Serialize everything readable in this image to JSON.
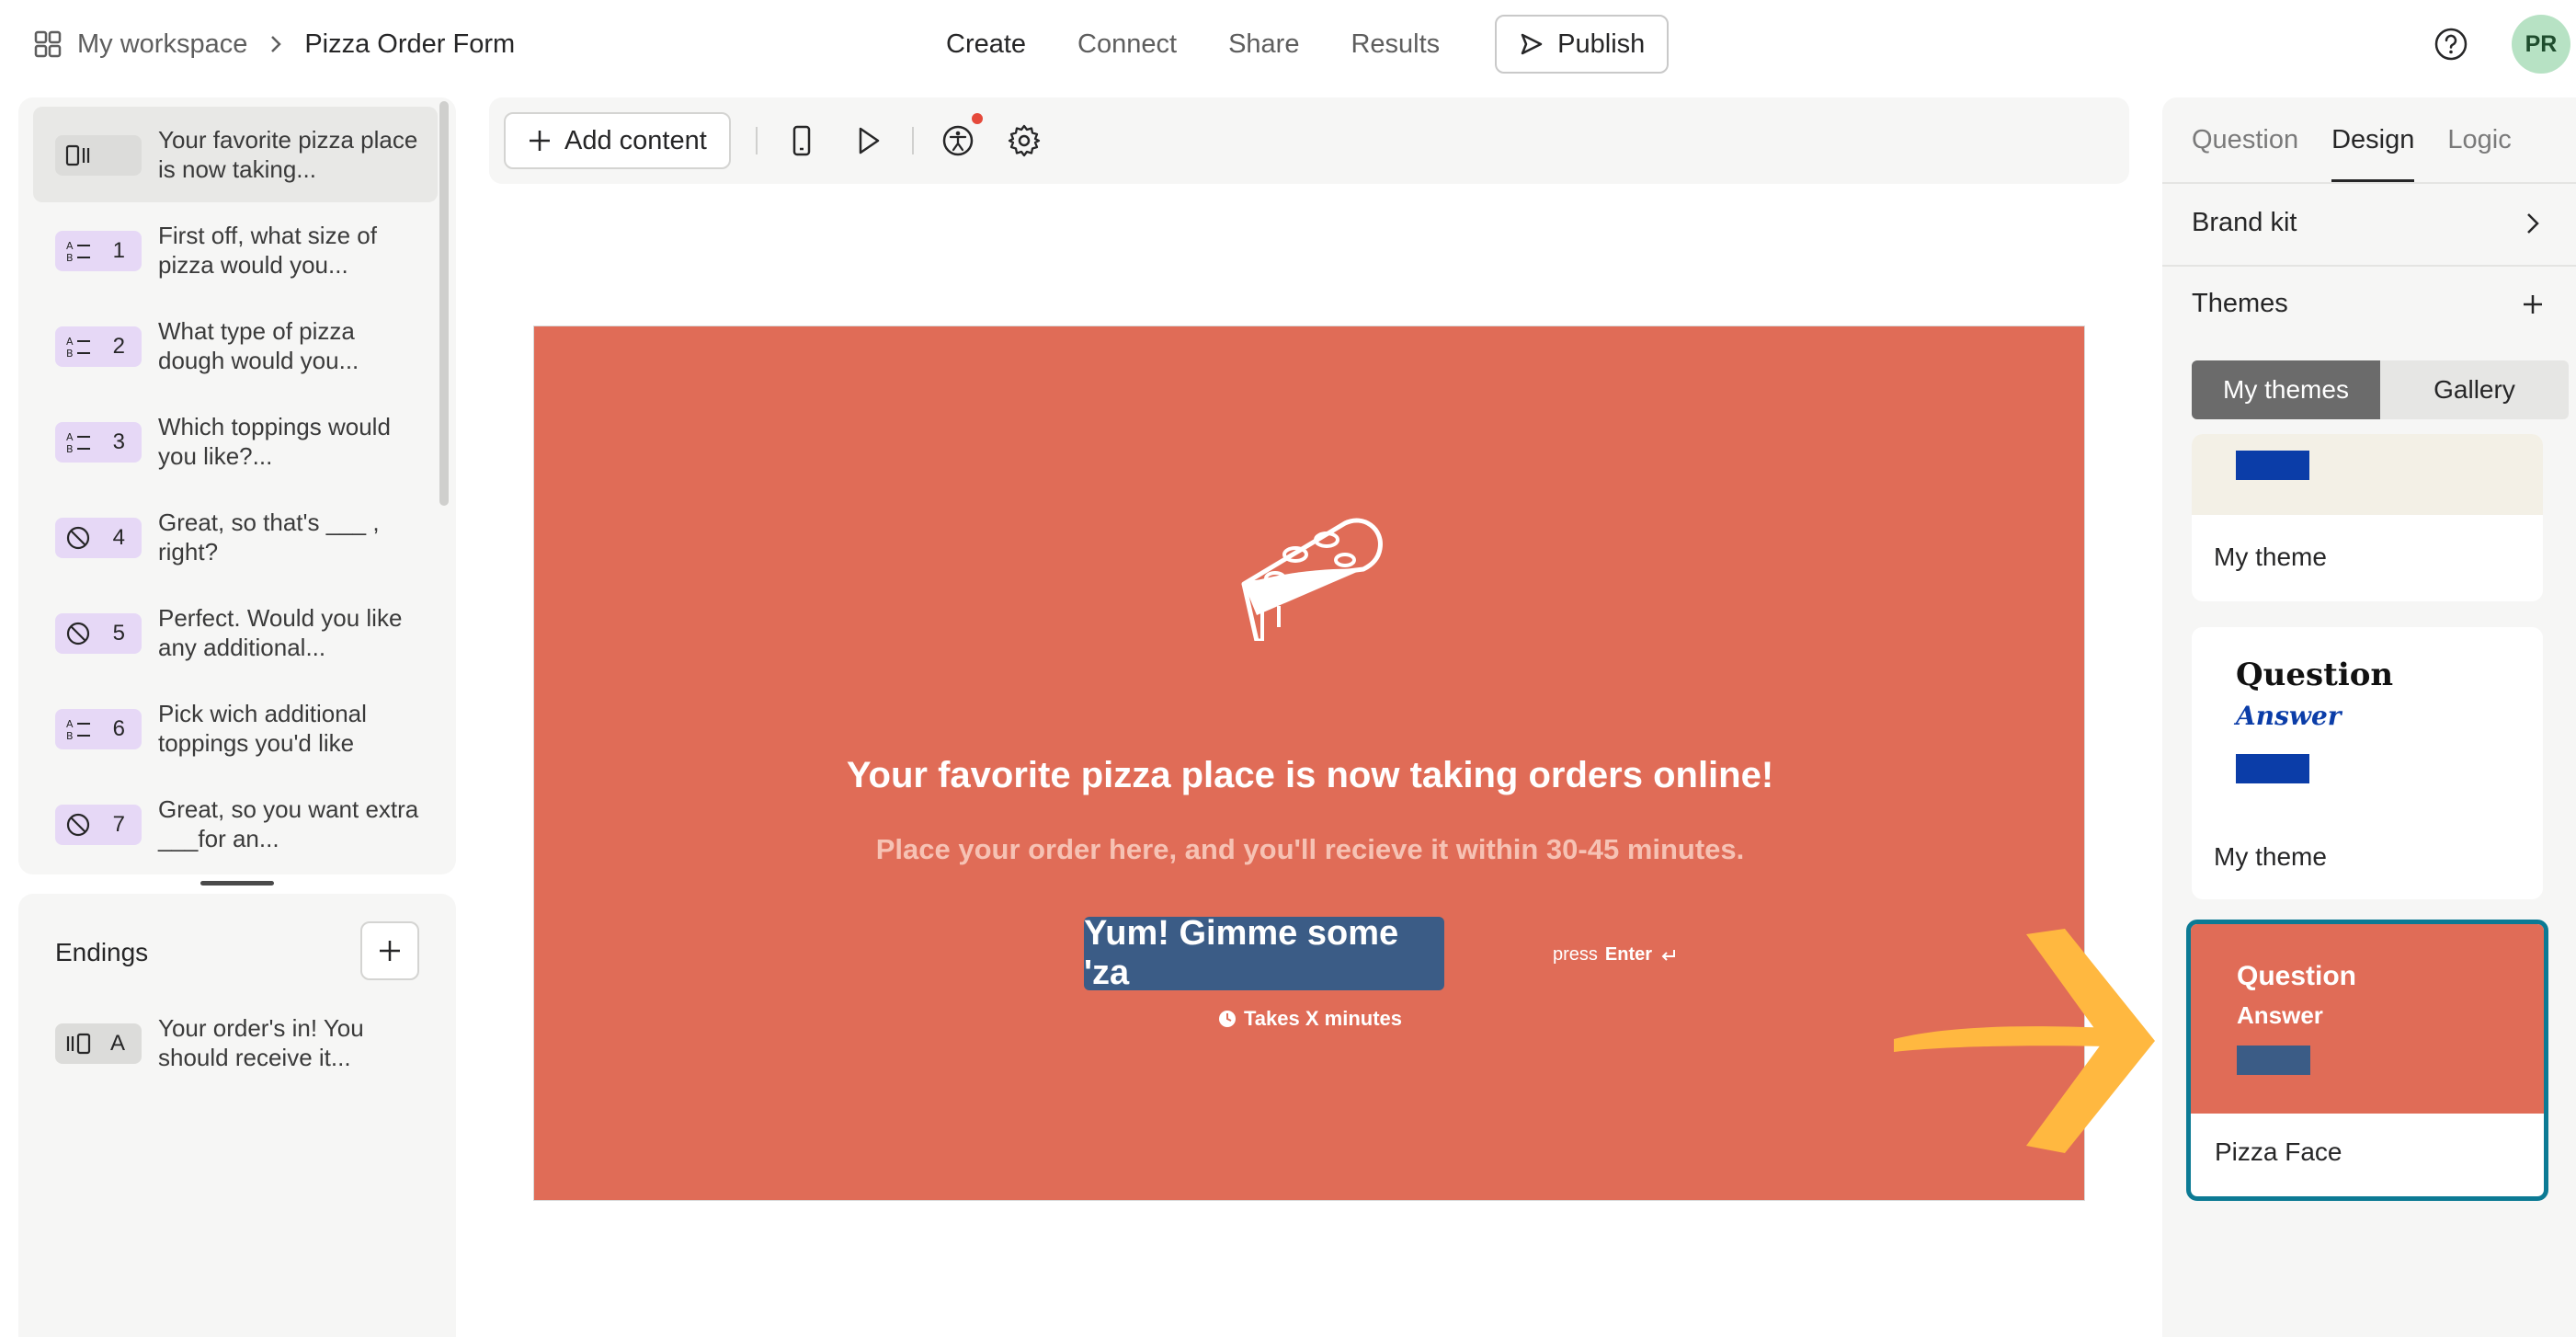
{
  "header": {
    "workspace": "My workspace",
    "form_name": "Pizza Order Form",
    "nav": [
      "Create",
      "Connect",
      "Share",
      "Results"
    ],
    "publish": "Publish",
    "avatar": "PR"
  },
  "questions": [
    {
      "num": "",
      "text": "Your favorite pizza place is now taking...",
      "icon": "welcome-screen-icon"
    },
    {
      "num": "1",
      "text": "First off, what size of pizza would you...",
      "icon": "multiple-choice-icon"
    },
    {
      "num": "2",
      "text": "What type of pizza dough would you...",
      "icon": "multiple-choice-icon"
    },
    {
      "num": "3",
      "text": "Which toppings would you like?...",
      "icon": "multiple-choice-icon"
    },
    {
      "num": "4",
      "text": "Great, so that's ___ , right?",
      "icon": "yes-no-icon"
    },
    {
      "num": "5",
      "text": "Perfect. Would you like any additional...",
      "icon": "yes-no-icon"
    },
    {
      "num": "6",
      "text": "Pick wich additional toppings you'd like",
      "icon": "multiple-choice-icon"
    },
    {
      "num": "7",
      "text": "Great, so you want extra ___for an...",
      "icon": "yes-no-icon"
    }
  ],
  "endings": {
    "title": "Endings",
    "items": [
      {
        "num": "A",
        "text": "Your order's in! You should receive it..."
      }
    ]
  },
  "toolbar": {
    "add_content": "Add content"
  },
  "stage": {
    "title": "Your favorite pizza place is now taking orders online!",
    "subtitle": "Place your order here, and you'll recieve it within 30-45 minutes.",
    "cta": "Yum! Gimme some 'za",
    "press": "press",
    "enter": "Enter",
    "takes": "Takes X minutes",
    "background": "#e06c57",
    "button_color": "#3b5c86"
  },
  "design": {
    "tabs": [
      "Question",
      "Design",
      "Logic"
    ],
    "brand_kit": "Brand kit",
    "themes": "Themes",
    "seg": [
      "My themes",
      "Gallery"
    ],
    "cards": [
      {
        "label": "My theme"
      },
      {
        "q": "Question",
        "a": "Answer",
        "label": "My theme"
      },
      {
        "q": "Question",
        "a": "Answer",
        "label": "Pizza Face"
      }
    ]
  },
  "colors": {
    "accent": "#0c7a94",
    "arrow": "#ffb840",
    "theme_blue": "#0b3da8"
  }
}
